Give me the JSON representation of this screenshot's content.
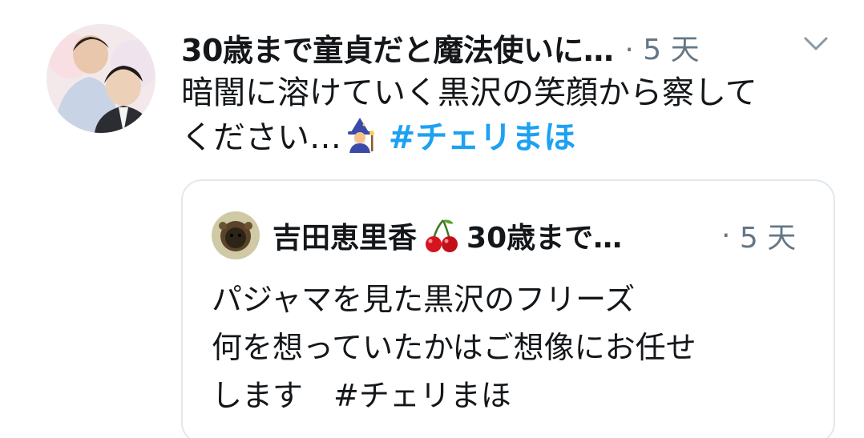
{
  "tweet": {
    "author_name": "30歳まで童貞だと魔法使いに…",
    "separator": "·",
    "time": "5 天",
    "text_line1": "暗闇に溶けていく黒沢の笑顔から察して",
    "text_line2": "ください…",
    "hashtag": "#チェリまほ"
  },
  "quote": {
    "author_name": "吉田恵里香",
    "handle": "30歳まで…",
    "separator": "·",
    "time": "5 天",
    "lines": [
      "パジャマを見た黒沢のフリーズ",
      "何を想っていたかはご想像にお任せ",
      "します　#チェリまほ"
    ]
  },
  "colors": {
    "text": "#14171a",
    "secondary": "#657786",
    "hashtag": "#1da1f2",
    "border": "#e1e8ed"
  },
  "icons": {
    "chevron": "chevron-down-icon",
    "mage_emoji": "mage-emoji-icon",
    "cherry_emoji": "cherry-emoji-icon"
  }
}
